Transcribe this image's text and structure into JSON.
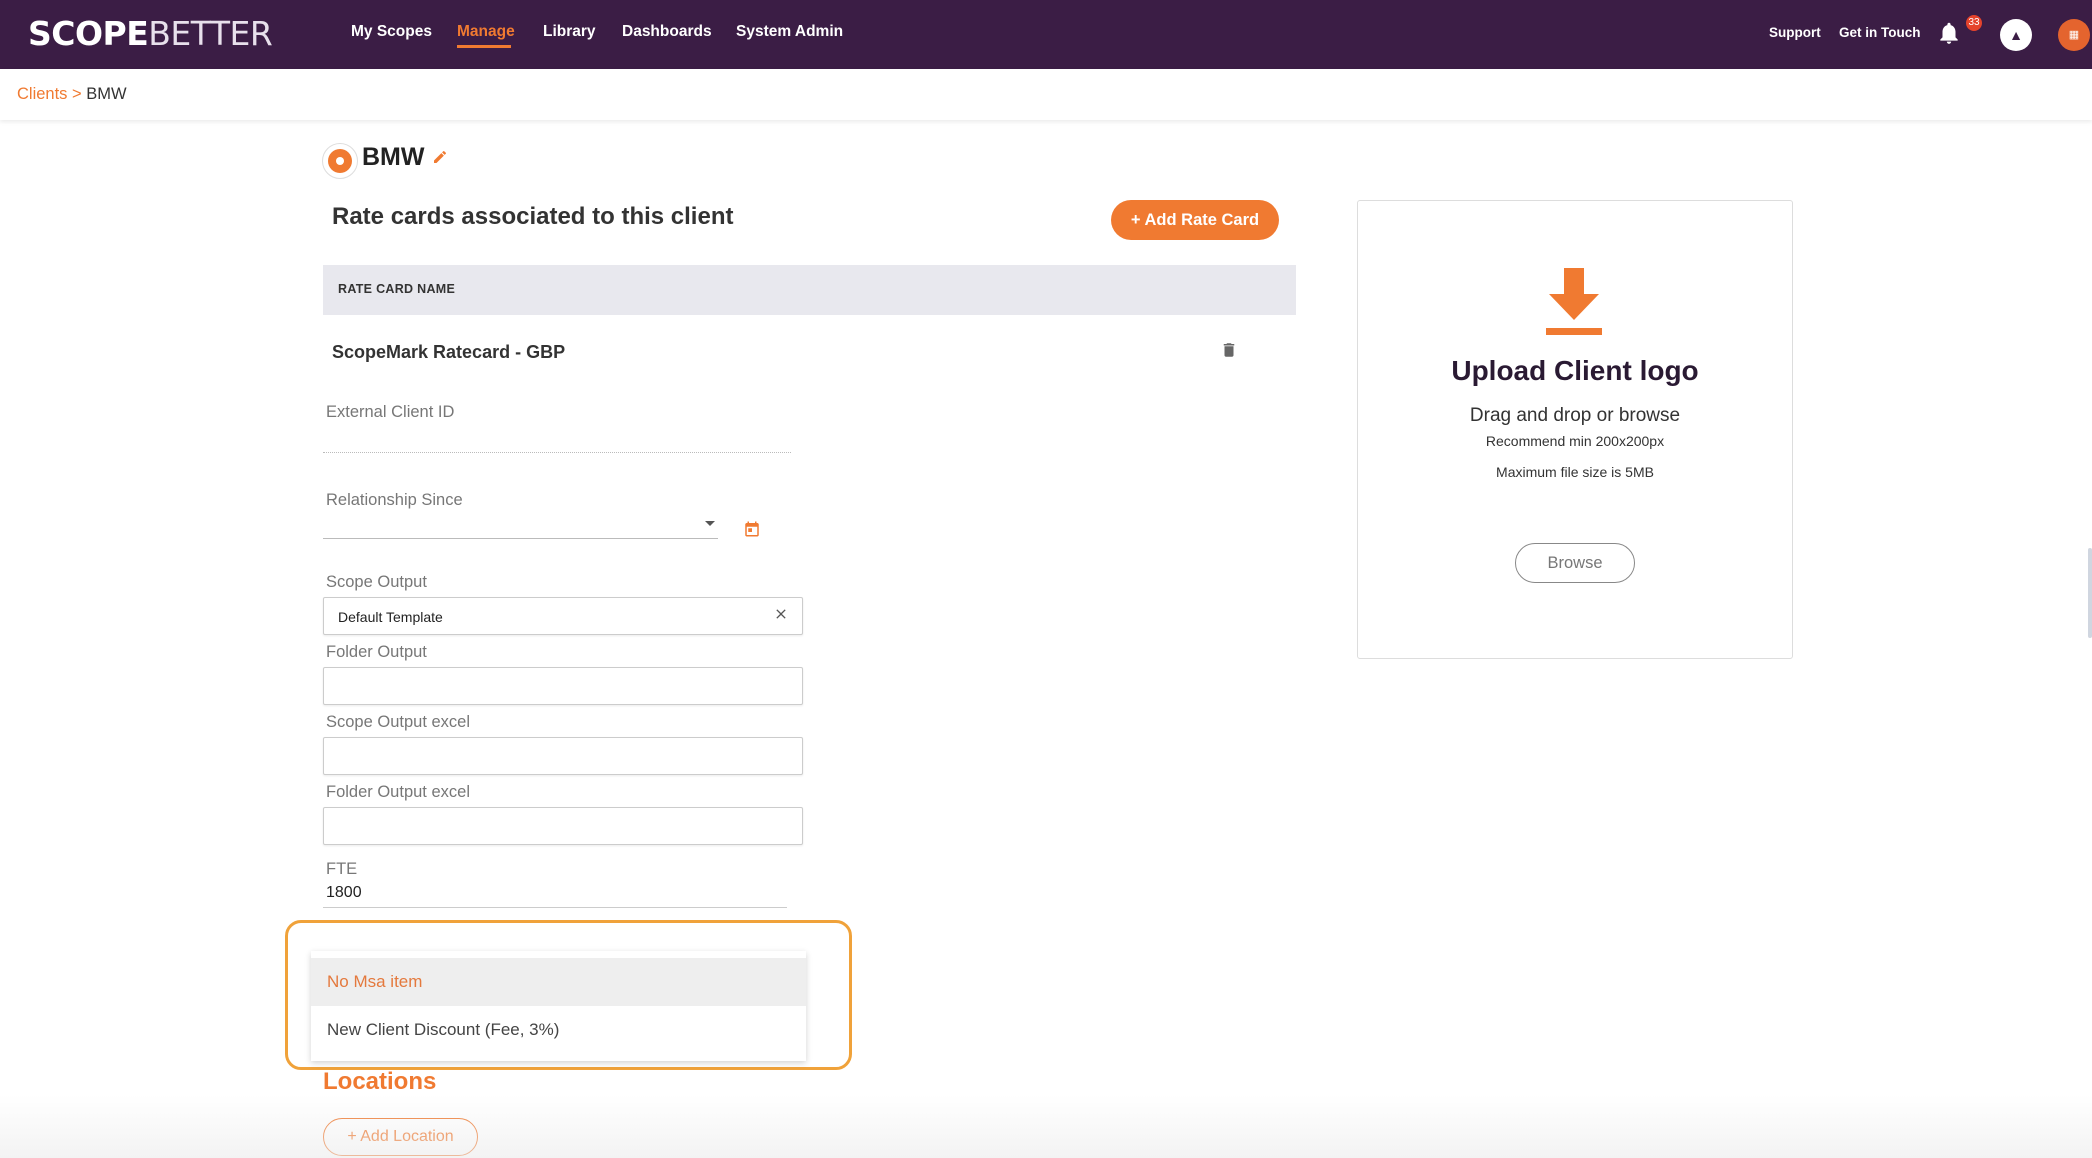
{
  "brand": {
    "logo_scope": "SCOPE",
    "logo_better": "BETTER"
  },
  "nav": {
    "items": [
      "My Scopes",
      "Manage",
      "Library",
      "Dashboards",
      "System Admin"
    ],
    "active": "Manage"
  },
  "header_links": {
    "support": "Support",
    "get_in_touch": "Get in Touch"
  },
  "notifications": {
    "count": "33"
  },
  "breadcrumb": {
    "parent": "Clients",
    "separator": ">",
    "current": "BMW"
  },
  "client": {
    "name": "BMW"
  },
  "rate_cards": {
    "title": "Rate cards associated to this client",
    "add_button": "+ Add Rate Card",
    "column_header": "RATE CARD NAME",
    "rows": [
      {
        "name": "ScopeMark Ratecard - GBP"
      }
    ]
  },
  "form": {
    "external_client_id": {
      "label": "External Client ID",
      "value": ""
    },
    "relationship_since": {
      "label": "Relationship Since",
      "value": ""
    },
    "scope_output": {
      "label": "Scope Output",
      "value": "Default Template"
    },
    "folder_output": {
      "label": "Folder Output",
      "value": ""
    },
    "scope_output_excel": {
      "label": "Scope Output excel",
      "value": ""
    },
    "folder_output_excel": {
      "label": "Folder Output excel",
      "value": ""
    },
    "fte": {
      "label": "FTE",
      "value": "1800"
    }
  },
  "msa_dropdown": {
    "options": [
      "No Msa item",
      "New Client Discount (Fee, 3%)"
    ],
    "selected": "No Msa item"
  },
  "locations": {
    "title": "Locations",
    "add_button": "+ Add Location"
  },
  "upload": {
    "title": "Upload Client logo",
    "subtitle": "Drag and drop or browse",
    "recommend": "Recommend min 200x200px",
    "max_size": "Maximum file size is 5MB",
    "browse_button": "Browse"
  },
  "colors": {
    "nav_bg": "#3b1d45",
    "accent": "#f07a31",
    "highlight": "#f0a23a"
  }
}
